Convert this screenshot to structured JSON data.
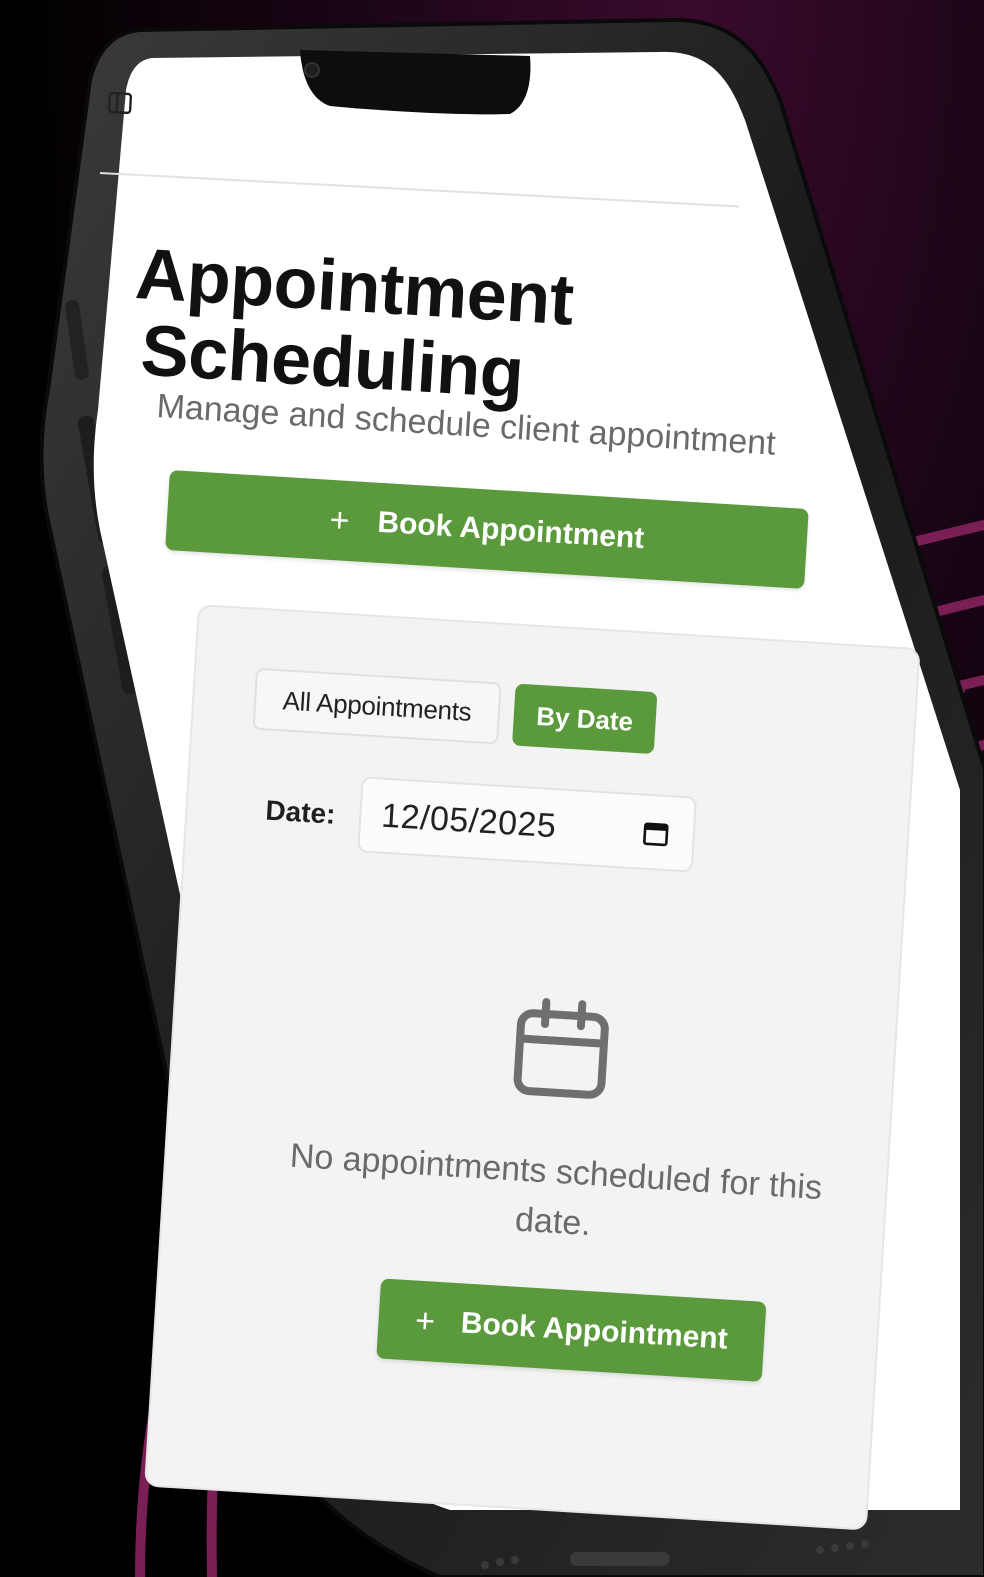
{
  "app": {
    "title_line1": "Appointment",
    "title_line2": "Scheduling",
    "subtitle": "Manage and schedule client appointments"
  },
  "header": {
    "sidebar_toggle_icon": "sidebar-toggle-icon"
  },
  "actions": {
    "book_label": "Book Appointment",
    "plus": "+"
  },
  "tabs": [
    {
      "label": "All Appointments",
      "active": false
    },
    {
      "label": "By Date",
      "active": true
    }
  ],
  "filter": {
    "date_label": "Date:",
    "date_value": "12/05/2025",
    "calendar_icon": "calendar-icon"
  },
  "empty_state": {
    "icon": "calendar-icon",
    "message": "No appointments scheduled for this date.",
    "button_label": "Book Appointment"
  },
  "colors": {
    "accent": "#5b9a3c",
    "background": "#000000",
    "arc": "#7a1e56",
    "screen": "#ffffff",
    "panel": "#f3f3f3"
  }
}
